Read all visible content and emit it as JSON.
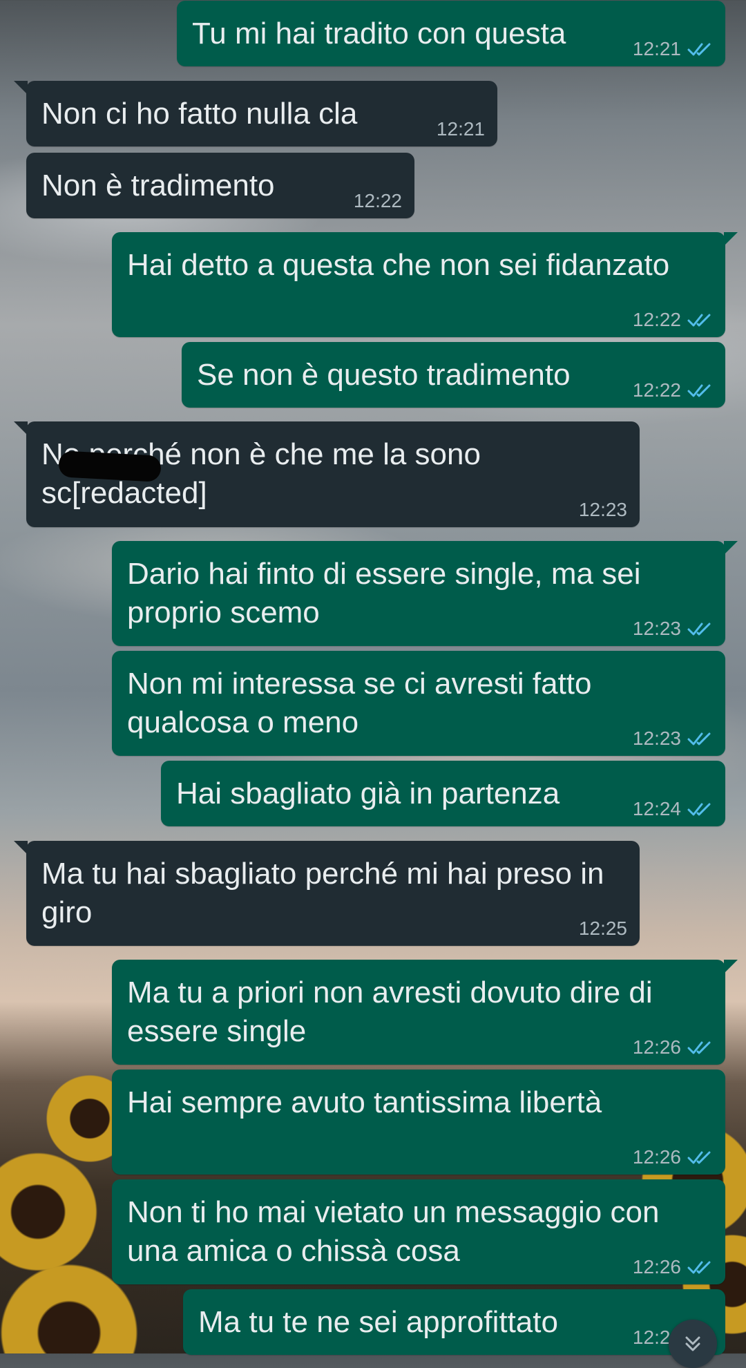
{
  "conversation": {
    "messages": [
      {
        "direction": "outgoing",
        "text": "Tu mi hai tradito con questa",
        "time": "12:21",
        "status": "read"
      },
      {
        "direction": "incoming",
        "text": "Non ci ho fatto nulla cla",
        "time": "12:21"
      },
      {
        "direction": "incoming",
        "text": "Non è tradimento",
        "time": "12:22"
      },
      {
        "direction": "outgoing",
        "text": "Hai detto a questa che non sei fidanzato",
        "time": "12:22",
        "status": "read"
      },
      {
        "direction": "outgoing",
        "text": "Se non è questo tradimento",
        "time": "12:22",
        "status": "read"
      },
      {
        "direction": "incoming",
        "text": "No perché non è che me la sono\nsc[redacted]",
        "time": "12:23"
      },
      {
        "direction": "outgoing",
        "text": "Dario hai finto di essere single, ma sei proprio scemo",
        "time": "12:23",
        "status": "read"
      },
      {
        "direction": "outgoing",
        "text": "Non mi interessa se ci avresti fatto qualcosa o meno",
        "time": "12:23",
        "status": "read"
      },
      {
        "direction": "outgoing",
        "text": "Hai sbagliato già in partenza",
        "time": "12:24",
        "status": "read"
      },
      {
        "direction": "incoming",
        "text": "Ma tu hai sbagliato perché mi hai preso in giro",
        "time": "12:25"
      },
      {
        "direction": "outgoing",
        "text": "Ma tu a priori non avresti dovuto dire di essere single",
        "time": "12:26",
        "status": "read"
      },
      {
        "direction": "outgoing",
        "text": "Hai sempre avuto tantissima libertà",
        "time": "12:26",
        "status": "read"
      },
      {
        "direction": "outgoing",
        "text": "Non ti ho mai vietato un messaggio con una amica o chissà cosa",
        "time": "12:26",
        "status": "read"
      },
      {
        "direction": "outgoing",
        "text": "Ma tu te ne sei approfittato",
        "time": "12:26",
        "status": "read"
      }
    ]
  },
  "ui": {
    "scroll_button_icon": "double-chevron-down-icon",
    "read_receipt_icon": "double-check-icon",
    "colors": {
      "outgoing_bubble": "#005c4b",
      "incoming_bubble": "#202c33",
      "text": "#e9edef",
      "timestamp": "#aebac1",
      "read_tick": "#53bdeb"
    }
  }
}
